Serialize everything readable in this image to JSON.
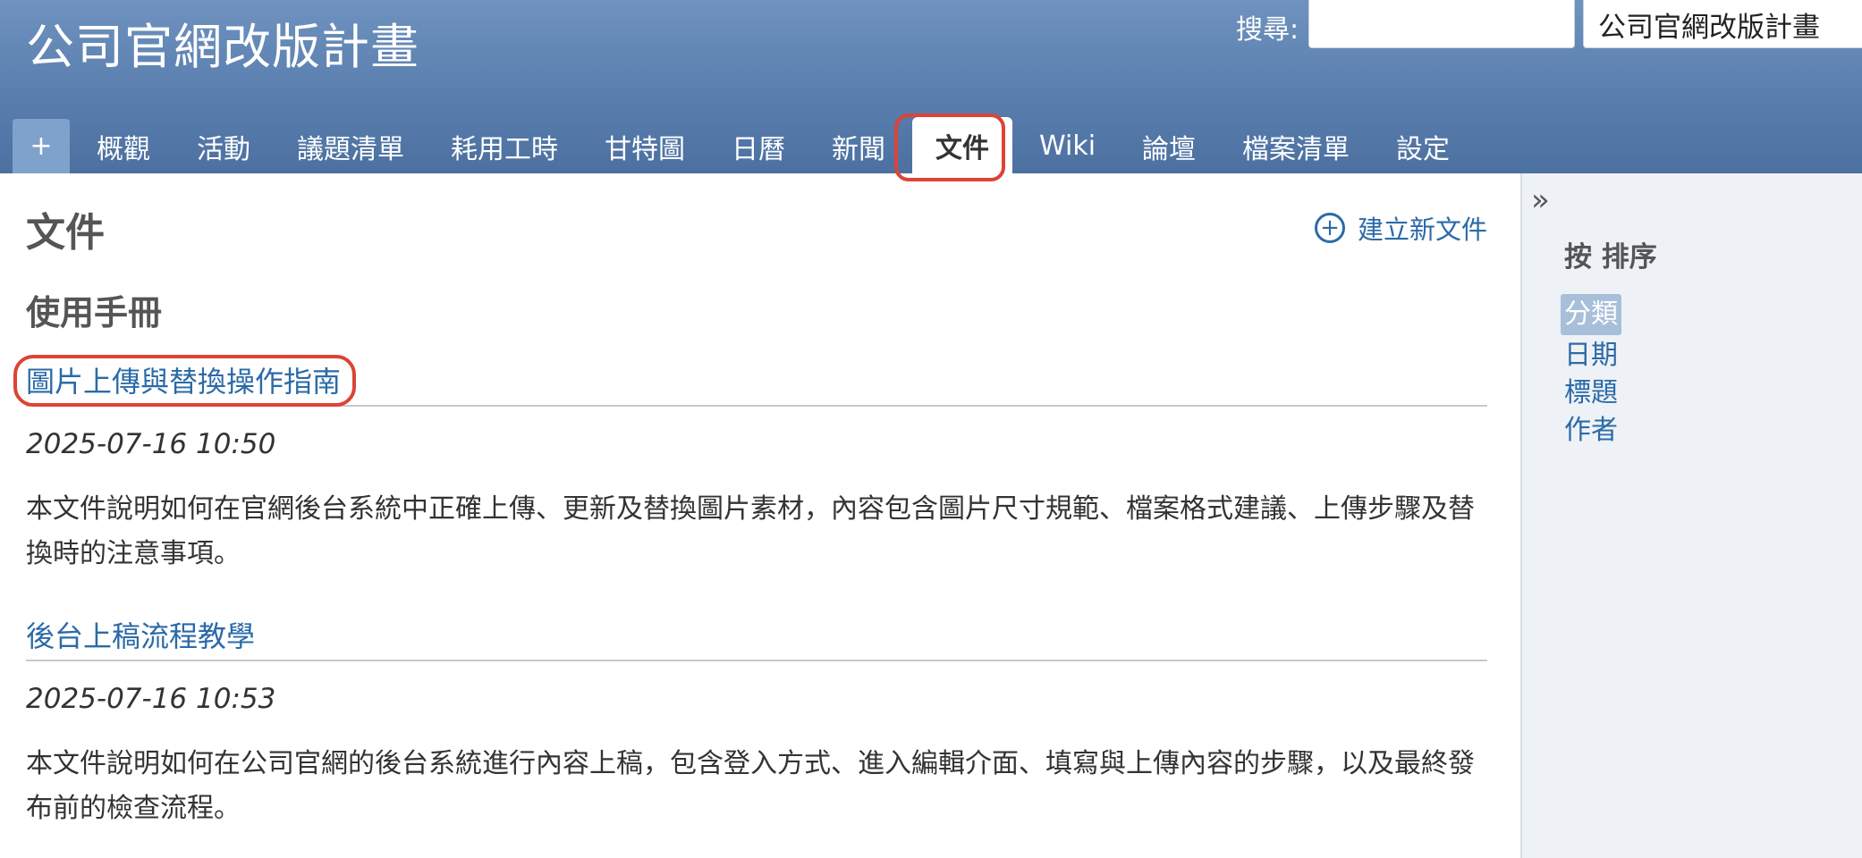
{
  "header": {
    "app_title": "公司官網改版計畫",
    "search_label": "搜尋:",
    "search_value": "",
    "project_selector": "公司官網改版計畫"
  },
  "tabs": [
    {
      "label": "+"
    },
    {
      "label": "概觀"
    },
    {
      "label": "活動"
    },
    {
      "label": "議題清單"
    },
    {
      "label": "耗用工時"
    },
    {
      "label": "甘特圖"
    },
    {
      "label": "日曆"
    },
    {
      "label": "新聞"
    },
    {
      "label": "文件",
      "selected": true
    },
    {
      "label": "Wiki"
    },
    {
      "label": "論壇"
    },
    {
      "label": "檔案清單"
    },
    {
      "label": "設定"
    }
  ],
  "main": {
    "page_title": "文件",
    "new_document_label": "建立新文件",
    "category": "使用手冊",
    "documents": [
      {
        "title": "圖片上傳與替換操作指南",
        "date": "2025-07-16 10:50",
        "description": "本文件說明如何在官網後台系統中正確上傳、更新及替換圖片素材，內容包含圖片尺寸規範、檔案格式建議、上傳步驟及替換時的注意事項。"
      },
      {
        "title": "後台上稿流程教學",
        "date": "2025-07-16 10:53",
        "description": "本文件說明如何在公司官網的後台系統進行內容上稿，包含登入方式、進入編輯介面、填寫與上傳內容的步驟，以及最終發布前的檢查流程。"
      }
    ]
  },
  "sidebar": {
    "collapse_icon": "»",
    "sort_heading": "按 排序",
    "sort_options": [
      {
        "label": "分類",
        "selected": true
      },
      {
        "label": "日期"
      },
      {
        "label": "標題"
      },
      {
        "label": "作者"
      }
    ]
  },
  "colors": {
    "header_top": "#6f92bf",
    "header_bottom": "#4c70a0",
    "link": "#2b6aa8",
    "highlight": "#db4437",
    "sidebar_bg": "#eef2f6",
    "selected_sort_bg": "#a8bfd9"
  }
}
